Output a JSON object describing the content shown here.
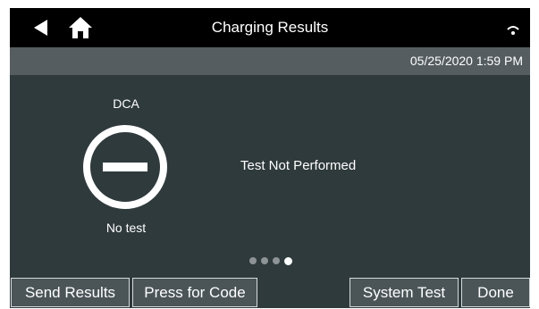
{
  "header": {
    "title": "Charging Results",
    "back_icon": "back-arrow-icon",
    "home_icon": "home-icon",
    "wifi_icon": "wifi-signal-icon"
  },
  "date_bar": {
    "datetime": "05/25/2020 1:59 PM"
  },
  "result": {
    "label": "DCA",
    "icon": "no-test-icon",
    "status": "No test",
    "message": "Test Not Performed"
  },
  "pager": {
    "pages": 4,
    "current": 4
  },
  "buttons": {
    "send_results": "Send Results",
    "press_for_code": "Press for Code",
    "system_test": "System Test",
    "done": "Done"
  },
  "colors": {
    "screen_bg": "#2f3a3c",
    "topbar_bg": "#000000",
    "datebar_bg": "#555d60",
    "button_bg": "#4b5558",
    "text": "#ffffff"
  }
}
